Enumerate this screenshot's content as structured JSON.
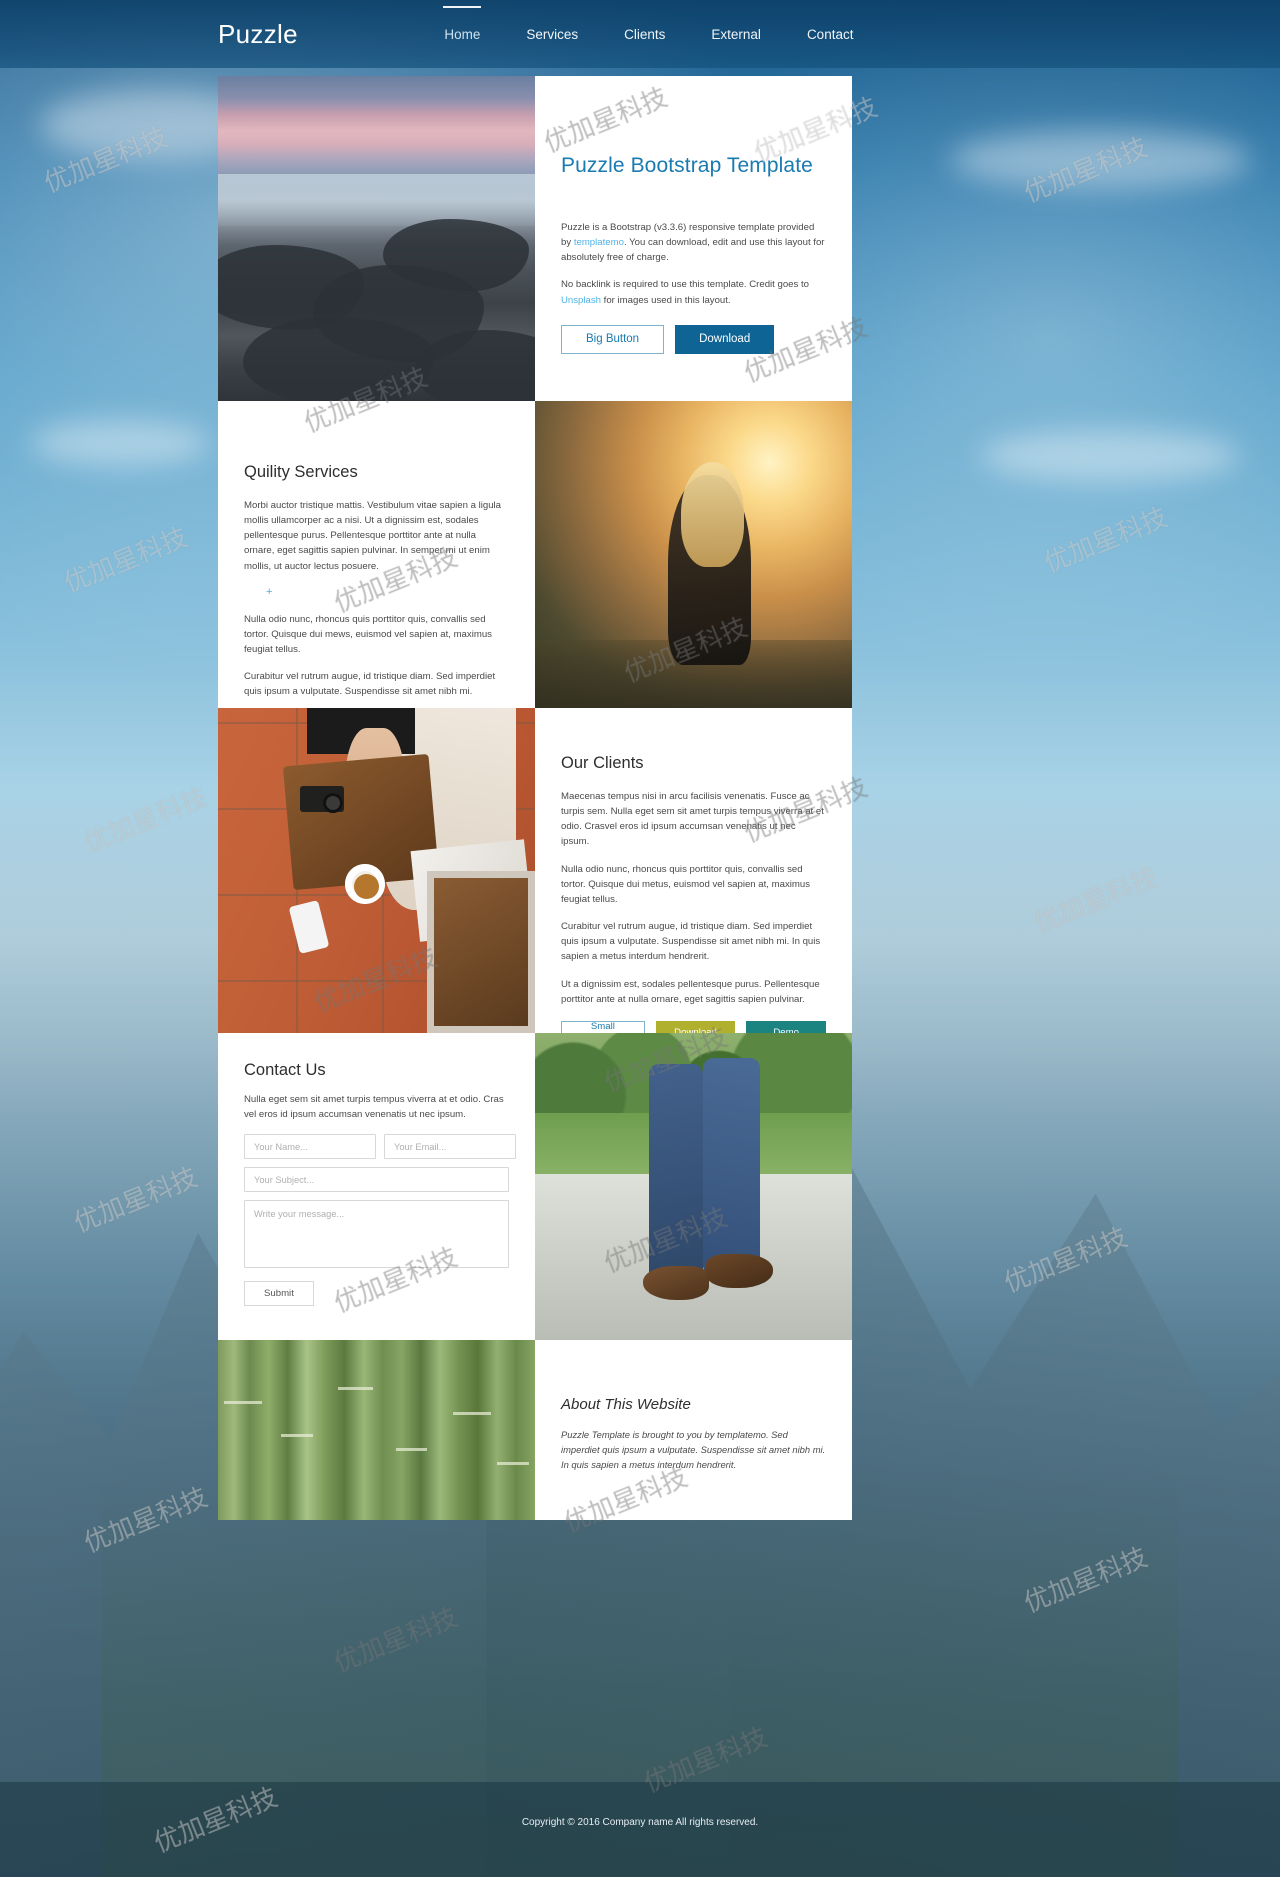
{
  "brand": "Puzzle",
  "nav": [
    {
      "label": "Home",
      "active": true
    },
    {
      "label": "Services",
      "active": false
    },
    {
      "label": "Clients",
      "active": false
    },
    {
      "label": "External",
      "active": false
    },
    {
      "label": "Contact",
      "active": false
    }
  ],
  "hero": {
    "title": "Puzzle Bootstrap Template",
    "paragraph1_pre": "Puzzle is a Bootstrap (v3.3.6) responsive template provided by ",
    "paragraph1_link": "templatemo",
    "paragraph1_post": ". You can download, edit and use this layout for absolutely free of charge.",
    "paragraph2_pre": "No backlink is required to use this template. Credit goes to ",
    "paragraph2_link": "Unsplash",
    "paragraph2_post": " for images used in this layout.",
    "btn_outline": "Big Button",
    "btn_primary": "Download"
  },
  "services": {
    "title": "Quility Services",
    "paragraph1": "Morbi auctor tristique mattis. Vestibulum vitae sapien a ligula mollis ullamcorper ac a nisi. Ut a dignissim est, sodales pellentesque purus. Pellentesque porttitor ante at nulla ornare, eget sagittis sapien pulvinar. In semper mi ut enim mollis, ut auctor lectus posuere.",
    "plus": "+",
    "paragraph2": "Nulla odio nunc, rhoncus quis porttitor quis, convallis sed tortor. Quisque dui mews, euismod vel sapien at, maximus feugiat tellus.",
    "paragraph3": "Curabitur vel rutrum augue, id tristique diam. Sed imperdiet quis ipsum a vulputate. Suspendisse sit amet nibh mi."
  },
  "clients": {
    "title": "Our Clients",
    "paragraph1": "Maecenas tempus nisi in arcu facilisis venenatis. Fusce ac turpis sem. Nulla eget sem sit amet turpis tempus viverra at et odio. Crasvel eros id ipsum accumsan venenatis ut nec ipsum.",
    "paragraph2": "Nulla odio nunc, rhoncus quis porttitor quis, convallis sed tortor. Quisque dui metus, euismod vel sapien at, maximus feugiat tellus.",
    "paragraph3": "Curabitur vel rutrum augue, id tristique diam. Sed imperdiet quis ipsum a vulputate. Suspendisse sit amet nibh mi. In quis sapien a metus interdum hendrerit.",
    "paragraph4": "Ut a dignissim est, sodales pellentesque purus. Pellentesque porttitor ante at nulla ornare, eget sagittis sapien pulvinar.",
    "btn_small": "Small Button",
    "btn_download": "Download",
    "btn_demo": "Demo"
  },
  "contact": {
    "title": "Contact Us",
    "paragraph": "Nulla eget sem sit amet turpis tempus viverra at et odio. Cras vel eros id ipsum accumsan venenatis ut nec ipsum.",
    "name_placeholder": "Your Name...",
    "email_placeholder": "Your Email...",
    "subject_placeholder": "Your Subject...",
    "message_placeholder": "Write your message...",
    "name_value": "",
    "email_value": "",
    "subject_value": "",
    "message_value": "",
    "submit_label": "Submit"
  },
  "about": {
    "title": "About This Website",
    "paragraph": "Puzzle Template is brought to you by templatemo. Sed imperdiet quis ipsum a vulputate. Suspendisse sit amet nibh mi. In quis sapien a metus interdum hendrerit."
  },
  "footer": {
    "copyright": "Copyright © 2016 Company name All rights reserved."
  },
  "watermark": {
    "text": "优加星科技"
  },
  "colors": {
    "accent_blue": "#1a7bb0",
    "primary_button": "#0f6496",
    "olive_button": "#b0b02e",
    "teal_button": "#1b8380",
    "link_blue": "#4fb3e8",
    "nav_bar": "#0d416a"
  }
}
